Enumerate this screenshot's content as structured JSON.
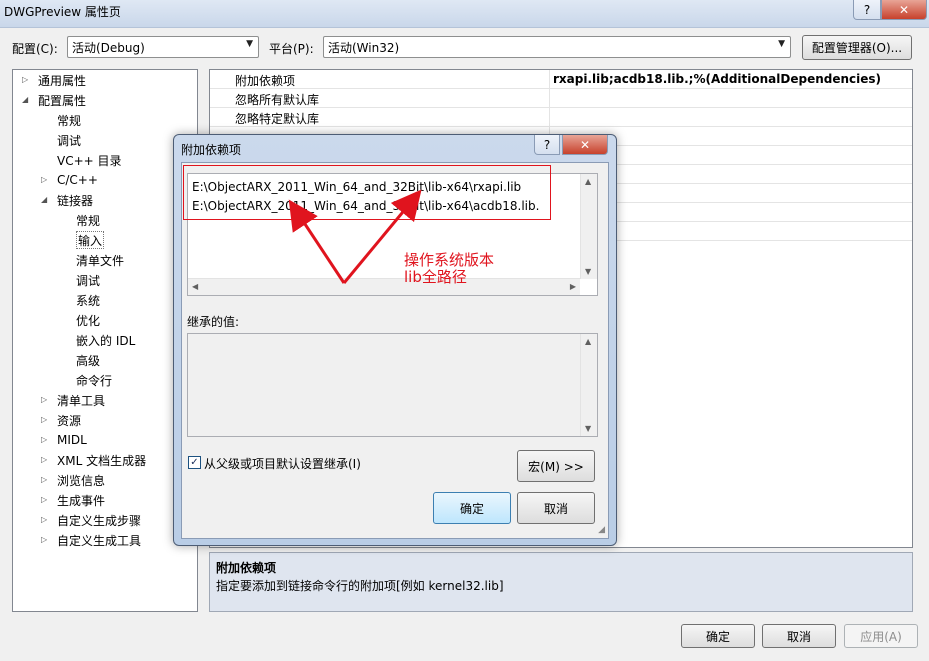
{
  "window": {
    "title": "DWGPreview 属性页",
    "help_label": "?",
    "close_label": "✕"
  },
  "toolbar": {
    "config_label": "配置(C):",
    "config_value": "活动(Debug)",
    "platform_label": "平台(P):",
    "platform_value": "活动(Win32)",
    "config_manager_label": "配置管理器(O)..."
  },
  "tree": {
    "items": [
      {
        "label": "通用属性",
        "twisty": "▷"
      },
      {
        "label": "配置属性",
        "twisty": "◢"
      },
      {
        "label": "常规",
        "twisty": ""
      },
      {
        "label": "调试",
        "twisty": ""
      },
      {
        "label": "VC++ 目录",
        "twisty": ""
      },
      {
        "label": "C/C++",
        "twisty": "▷"
      },
      {
        "label": "链接器",
        "twisty": "◢"
      },
      {
        "label": "常规",
        "twisty": ""
      },
      {
        "label": "输入",
        "twisty": ""
      },
      {
        "label": "清单文件",
        "twisty": ""
      },
      {
        "label": "调试",
        "twisty": ""
      },
      {
        "label": "系统",
        "twisty": ""
      },
      {
        "label": "优化",
        "twisty": ""
      },
      {
        "label": "嵌入的 IDL",
        "twisty": ""
      },
      {
        "label": "高级",
        "twisty": ""
      },
      {
        "label": "命令行",
        "twisty": ""
      },
      {
        "label": "清单工具",
        "twisty": "▷"
      },
      {
        "label": "资源",
        "twisty": "▷"
      },
      {
        "label": "MIDL",
        "twisty": "▷"
      },
      {
        "label": "XML 文档生成器",
        "twisty": "▷"
      },
      {
        "label": "浏览信息",
        "twisty": "▷"
      },
      {
        "label": "生成事件",
        "twisty": "▷"
      },
      {
        "label": "自定义生成步骤",
        "twisty": "▷"
      },
      {
        "label": "自定义生成工具",
        "twisty": "▷"
      }
    ]
  },
  "grid": {
    "rows": [
      {
        "key": "附加依赖项",
        "value": "rxapi.lib;acdb18.lib.;%(AdditionalDependencies)"
      },
      {
        "key": "忽略所有默认库",
        "value": ""
      },
      {
        "key": "忽略特定默认库",
        "value": ""
      }
    ]
  },
  "description": {
    "title": "附加依赖项",
    "text": "指定要添加到链接命令行的附加项[例如 kernel32.lib]"
  },
  "dialog": {
    "title": "附加依赖项",
    "help_label": "?",
    "close_label": "✕",
    "lines": [
      "E:\\ObjectARX_2011_Win_64_and_32Bit\\lib-x64\\rxapi.lib",
      "E:\\ObjectARX_2011_Win_64_and_32Bit\\lib-x64\\acdb18.lib."
    ],
    "inherited_label": "继承的值:",
    "inherit_checkbox_label": "从父级或项目默认设置继承(I)",
    "inherit_checked": true,
    "check_mark": "✓",
    "macro_button": "宏(M) >>",
    "ok_button": "确定",
    "cancel_button": "取消"
  },
  "annotation": {
    "lines": [
      "操作系统版本",
      "lib全路径"
    ],
    "color": "#e0141e"
  },
  "footer": {
    "ok": "确定",
    "cancel": "取消",
    "apply": "应用(A)"
  },
  "colors": {
    "default_button": "#bee6fd",
    "annotation_red": "#e0141e"
  }
}
